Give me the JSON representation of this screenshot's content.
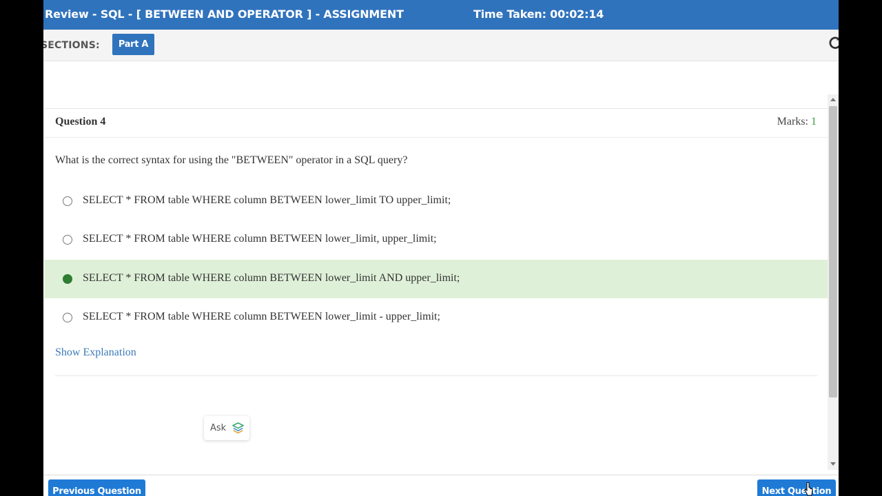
{
  "header": {
    "title": "Review - SQL - [ BETWEEN AND OPERATOR ] - ASSIGNMENT",
    "timer": "Time Taken: 00:02:14"
  },
  "sections": {
    "label": "SECTIONS:",
    "active": "Part A",
    "refresh_icon": "refresh-icon"
  },
  "question": {
    "title": "Question 4",
    "marks_label": "Marks:",
    "marks_value": "1",
    "text": "What is the correct syntax for using the \"BETWEEN\" operator in a SQL query?",
    "options": [
      {
        "text": "SELECT * FROM table WHERE column BETWEEN lower_limit TO upper_limit;",
        "selected": false
      },
      {
        "text": "SELECT * FROM table WHERE column BETWEEN lower_limit, upper_limit;",
        "selected": false
      },
      {
        "text": "SELECT * FROM table WHERE column BETWEEN lower_limit AND upper_limit;",
        "selected": true
      },
      {
        "text": "SELECT * FROM table WHERE column BETWEEN lower_limit - upper_limit;",
        "selected": false
      }
    ],
    "show_explanation": "Show Explanation"
  },
  "ask": {
    "label": "Ask",
    "icon": "layers-icon"
  },
  "footer": {
    "prev_label": "Previous Question",
    "next_label": "Next Question"
  },
  "colors": {
    "primary": "#3073bd",
    "button_blue": "#1f7ad6",
    "selected_bg": "#dff0d8",
    "selected_radio": "#2e7d32",
    "link": "#3b7ab8",
    "marks_green": "#3a9a3a"
  }
}
